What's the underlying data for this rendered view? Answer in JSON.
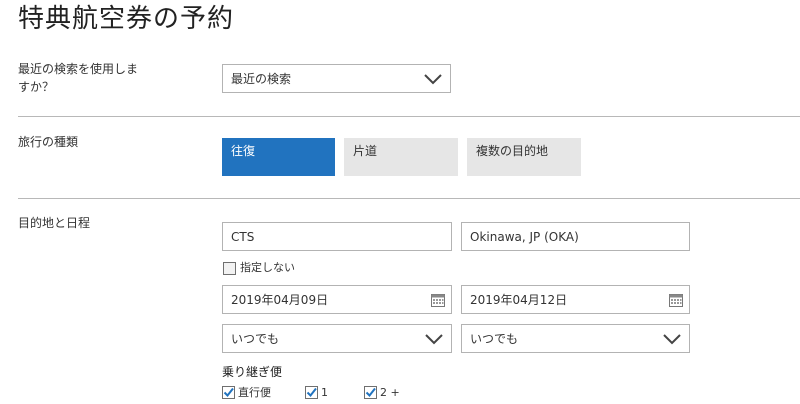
{
  "page": {
    "title": "特典航空券の予約"
  },
  "recent_search": {
    "label_line1": "最近の検索を使用しま",
    "label_line2": "すか？",
    "select_value": "最近の検索"
  },
  "trip_type": {
    "label": "旅行の種類",
    "options": [
      "往復",
      "片道",
      "複数の目的地"
    ],
    "selected": "往復"
  },
  "itinerary": {
    "label": "目的地と日程",
    "origin": "CTS",
    "destination": "Okinawa, JP (OKA)",
    "flexible_label": "指定しない",
    "flexible_checked": false,
    "depart_date": "2019年04月09日",
    "return_date": "2019年04月12日",
    "depart_time": "いつでも",
    "return_time": "いつでも"
  },
  "connections": {
    "label": "乗り継ぎ便",
    "options": [
      {
        "label": "直行便",
        "checked": true
      },
      {
        "label": "1",
        "checked": true
      },
      {
        "label": "2 +",
        "checked": true
      }
    ]
  },
  "colors": {
    "accent": "#2173bf",
    "idle_tab": "#e6e6e6",
    "border": "#b3b3b3",
    "check": "#2173bf"
  },
  "icons": {
    "dropdown": "chevron-down-icon",
    "calendar": "calendar-icon",
    "checkbox": "checkmark-icon"
  }
}
